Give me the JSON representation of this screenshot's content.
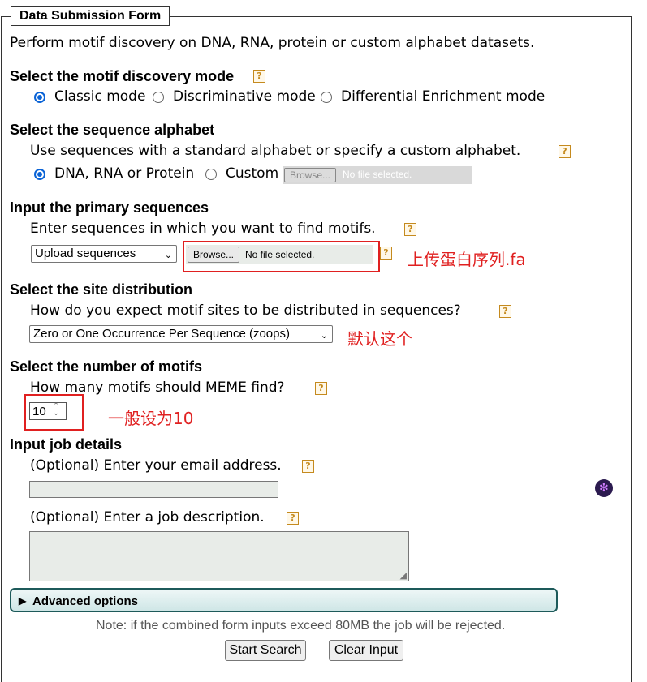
{
  "form": {
    "legend": "Data Submission Form",
    "intro": "Perform motif discovery on DNA, RNA, protein or custom alphabet datasets."
  },
  "mode": {
    "heading": "Select the motif discovery mode",
    "options": [
      "Classic mode",
      "Discriminative mode",
      "Differential Enrichment mode"
    ],
    "selected": "Classic mode"
  },
  "alphabet": {
    "heading": "Select the sequence alphabet",
    "desc": "Use sequences with a standard alphabet or specify a custom alphabet.",
    "options": [
      "DNA, RNA or Protein",
      "Custom"
    ],
    "browse_label": "Browse...",
    "file_status": "No file selected."
  },
  "primary": {
    "heading": "Input the primary sequences",
    "desc": "Enter sequences in which you want to find motifs.",
    "select_value": "Upload sequences",
    "browse_label": "Browse...",
    "file_status": "No file selected.",
    "annotation": "上传蛋白序列.fa"
  },
  "distribution": {
    "heading": "Select the site distribution",
    "desc": "How do you expect motif sites to be distributed in sequences?",
    "select_value": "Zero or One Occurrence Per Sequence (zoops)",
    "annotation": "默认这个"
  },
  "motifs": {
    "heading": "Select the number of motifs",
    "desc": "How many motifs should MEME find?",
    "value": "10",
    "annotation": "一般设为10"
  },
  "job": {
    "heading": "Input job details",
    "email_label": "(Optional) Enter your email address.",
    "desc_label": "(Optional) Enter a job description."
  },
  "advanced": {
    "label": "Advanced options"
  },
  "note": "Note: if the combined form inputs exceed 80MB the job will be rejected.",
  "buttons": {
    "start": "Start Search",
    "clear": "Clear Input"
  },
  "help_glyph": "?",
  "icons": {
    "triangle": "▶",
    "caret": "⌄",
    "spinner": "⌃⌄"
  },
  "colors": {
    "accent": "#0a63d6",
    "annotation_red": "#e02020",
    "help": "#c58a1e"
  }
}
